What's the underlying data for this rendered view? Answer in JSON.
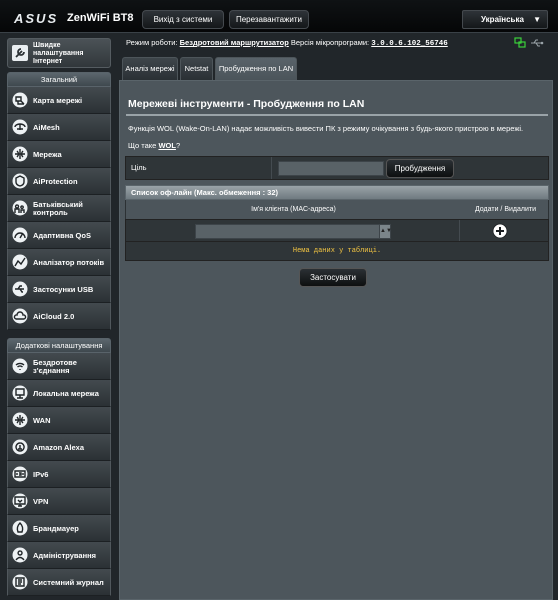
{
  "header": {
    "brand": "ASUS",
    "model": "ZenWiFi BT8",
    "logout_label": "Вихід з системи",
    "reboot_label": "Перезавантажити",
    "language": "Українська"
  },
  "info": {
    "mode_label": "Режим роботи:",
    "mode_value": "Бездротовий маршрутизатор",
    "fw_label": "Версія мікропрограми:",
    "fw_value": "3.0.0.6.102_56746"
  },
  "sidebar": {
    "quick_setup": "Швидке налаштування Інтернет",
    "general_title": "Загальний",
    "general_items": [
      {
        "label": "Карта мережі",
        "icon": "network-map-icon"
      },
      {
        "label": "AiMesh",
        "icon": "aimesh-icon"
      },
      {
        "label": "Мережа",
        "icon": "network-globe-icon"
      },
      {
        "label": "AiProtection",
        "icon": "aiprotection-icon"
      },
      {
        "label": "Батьківський контроль",
        "icon": "parental-control-icon"
      },
      {
        "label": "Адаптивна QoS",
        "icon": "qos-gauge-icon"
      },
      {
        "label": "Аналізатор потоків",
        "icon": "traffic-analyzer-icon"
      },
      {
        "label": "Застосунки USB",
        "icon": "usb-icon"
      },
      {
        "label": "AiCloud 2.0",
        "icon": "aicloud-icon"
      }
    ],
    "advanced_title": "Додаткові налаштування",
    "advanced_items": [
      {
        "label": "Бездротове з'єднання",
        "icon": "wireless-icon"
      },
      {
        "label": "Локальна мережа",
        "icon": "lan-icon"
      },
      {
        "label": "WAN",
        "icon": "wan-globe-icon"
      },
      {
        "label": "Amazon Alexa",
        "icon": "alexa-icon"
      },
      {
        "label": "IPv6",
        "icon": "ipv6-icon"
      },
      {
        "label": "VPN",
        "icon": "vpn-icon"
      },
      {
        "label": "Брандмауер",
        "icon": "firewall-icon"
      },
      {
        "label": "Адміністрування",
        "icon": "administration-icon"
      },
      {
        "label": "Системний журнал",
        "icon": "system-log-icon"
      }
    ]
  },
  "tabs": [
    {
      "label": "Аналіз мережі"
    },
    {
      "label": "Netstat"
    },
    {
      "label": "Пробудження по LAN"
    }
  ],
  "main": {
    "title": "Мережеві інструменти - Пробудження по LAN",
    "description": "Функція WOL (Wake-On-LAN) надає можливість вивести ПК з режиму очікування з будь-якого пристрою в мережі.",
    "wol_question_prefix": "Що таке",
    "wol_link": "WOL",
    "wol_question_suffix": "?",
    "target_label": "Ціль",
    "target_value": "",
    "wake_button": "Пробудження",
    "list_title": "Список оф-лайн (Макс. обмеження : 32)",
    "col_client": "Ім'я клієнта (MAC-адреса)",
    "col_action": "Додати / Видалити",
    "client_placeholder": "",
    "empty_text": "Нема даних у таблиці.",
    "apply_button": "Застосувати"
  }
}
